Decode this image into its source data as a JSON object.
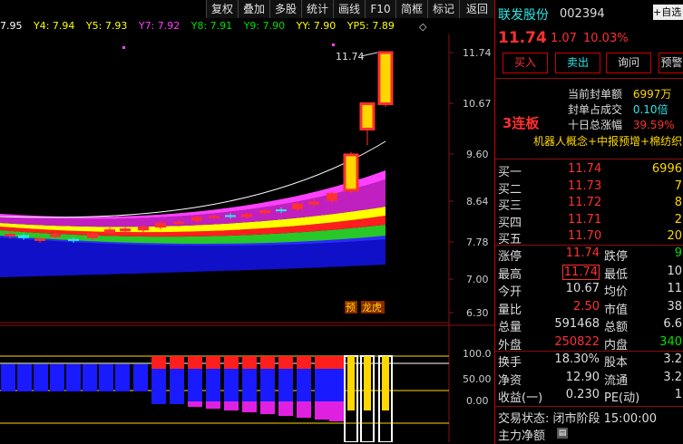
{
  "toolbar": {
    "items": [
      "复权",
      "叠加",
      "多股",
      "统计",
      "画线",
      "F10",
      "简框",
      "标记",
      "返回"
    ]
  },
  "ma_line": {
    "items": [
      {
        "label": "7.95",
        "color": "#ffffff"
      },
      {
        "label": "Y4: 7.94",
        "color": "#ffff00"
      },
      {
        "label": "Y5: 7.93",
        "color": "#ffff00"
      },
      {
        "label": "Y7: 7.92",
        "color": "#ff40ff"
      },
      {
        "label": "Y8: 7.91",
        "color": "#00e000"
      },
      {
        "label": "Y9: 7.90",
        "color": "#00e000"
      },
      {
        "label": "YY: 7.90",
        "color": "#ffff00"
      },
      {
        "label": "YP5: 7.89",
        "color": "#ffff00"
      }
    ]
  },
  "chart": {
    "price_axis": [
      "11.74",
      "10.67",
      "9.60",
      "8.64",
      "7.78",
      "7.00",
      "6.30"
    ],
    "osc_axis": [
      "100.0",
      "50.00",
      "0.00"
    ],
    "annotation_high": "11.74",
    "badge_1": "预",
    "badge_2": "龙虎"
  },
  "stock": {
    "name": "联发股份",
    "code": "002394",
    "price": "11.74",
    "change": "1.07",
    "change_pct": "10.03%",
    "buttons": [
      "买入",
      "卖出",
      "询问",
      "预警"
    ],
    "streak": "3连板",
    "info": [
      {
        "label": "当前封单额",
        "value": "6997万"
      },
      {
        "label": "封单占成交",
        "value": "0.10倍"
      },
      {
        "label": "十日总涨幅",
        "value": "39.59%"
      }
    ],
    "concepts": "机器人概念+中报预增+棉纺织",
    "bids": [
      {
        "label": "买一",
        "price": "11.74",
        "vol": "6996"
      },
      {
        "label": "买二",
        "price": "11.73",
        "vol": "7"
      },
      {
        "label": "买三",
        "price": "11.72",
        "vol": "8"
      },
      {
        "label": "买四",
        "price": "11.71",
        "vol": "2"
      },
      {
        "label": "买五",
        "price": "11.70",
        "vol": "20"
      }
    ],
    "stats": [
      {
        "l1": "涨停",
        "v1": "11.74",
        "l2": "跌停",
        "v2": "9"
      },
      {
        "l1": "最高",
        "v1": "11.74",
        "l2": "最低",
        "v2": "10"
      },
      {
        "l1": "今开",
        "v1": "10.67",
        "l2": "均价",
        "v2": "11"
      },
      {
        "l1": "量比",
        "v1": "2.50",
        "l2": "市值",
        "v2": "38"
      },
      {
        "l1": "总量",
        "v1": "591468",
        "l2": "总额",
        "v2": "6.6"
      },
      {
        "l1": "外盘",
        "v1": "250822",
        "l2": "内盘",
        "v2": "340"
      }
    ],
    "stats2": [
      {
        "l1": "换手",
        "v1": "18.30%",
        "l2": "股本",
        "v2": "3.2"
      },
      {
        "l1": "净资",
        "v1": "12.90",
        "l2": "流通",
        "v2": "3.2"
      },
      {
        "l1": "收益(一)",
        "v1": "0.230",
        "l2": "PE(动)",
        "v2": "1"
      }
    ],
    "trade_status": "交易状态: 闭市阶段 15:00:00",
    "main_flow": "主力净额"
  },
  "colors": {
    "up": "#ff3030",
    "down": "#2ee6e6",
    "accent": "#ffd700"
  }
}
